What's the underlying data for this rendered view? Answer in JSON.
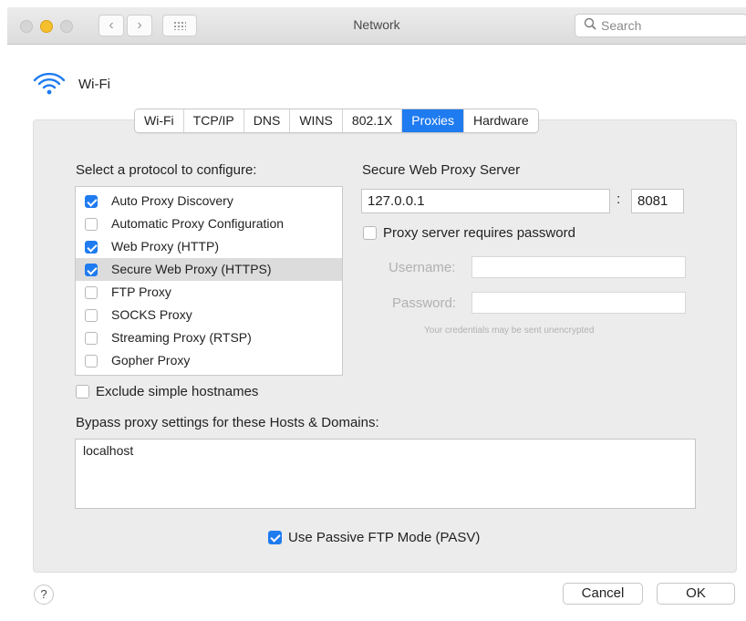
{
  "window": {
    "title": "Network"
  },
  "toolbar": {
    "back_glyph": "‹",
    "forward_glyph": "›",
    "search_placeholder": "Search",
    "search_icon": "search-icon"
  },
  "header": {
    "label": "Wi-Fi",
    "icon": "wifi-icon"
  },
  "tabs": [
    {
      "label": "Wi-Fi",
      "active": false
    },
    {
      "label": "TCP/IP",
      "active": false
    },
    {
      "label": "DNS",
      "active": false
    },
    {
      "label": "WINS",
      "active": false
    },
    {
      "label": "802.1X",
      "active": false
    },
    {
      "label": "Proxies",
      "active": true
    },
    {
      "label": "Hardware",
      "active": false
    }
  ],
  "protocols": {
    "heading": "Select a protocol to configure:",
    "items": [
      {
        "label": "Auto Proxy Discovery",
        "checked": true,
        "selected": false
      },
      {
        "label": "Automatic Proxy Configuration",
        "checked": false,
        "selected": false
      },
      {
        "label": "Web Proxy (HTTP)",
        "checked": true,
        "selected": false
      },
      {
        "label": "Secure Web Proxy (HTTPS)",
        "checked": true,
        "selected": true
      },
      {
        "label": "FTP Proxy",
        "checked": false,
        "selected": false
      },
      {
        "label": "SOCKS Proxy",
        "checked": false,
        "selected": false
      },
      {
        "label": "Streaming Proxy (RTSP)",
        "checked": false,
        "selected": false
      },
      {
        "label": "Gopher Proxy",
        "checked": false,
        "selected": false
      }
    ]
  },
  "proxy_server": {
    "heading": "Secure Web Proxy Server",
    "host": "127.0.0.1",
    "separator": ":",
    "port": "8081",
    "requires_password_label": "Proxy server requires password",
    "requires_password": false,
    "username_label": "Username:",
    "password_label": "Password:",
    "note": "Your credentials may be sent unencrypted"
  },
  "exclude_simple": {
    "label": "Exclude simple hostnames",
    "checked": false
  },
  "bypass": {
    "label": "Bypass proxy settings for these Hosts & Domains:",
    "value": "localhost"
  },
  "passive_ftp": {
    "label": "Use Passive FTP Mode (PASV)",
    "checked": true
  },
  "buttons": {
    "help": "?",
    "cancel": "Cancel",
    "ok": "OK"
  },
  "colors": {
    "accent": "#1f7bf0",
    "minimize": "#f6c02c"
  }
}
